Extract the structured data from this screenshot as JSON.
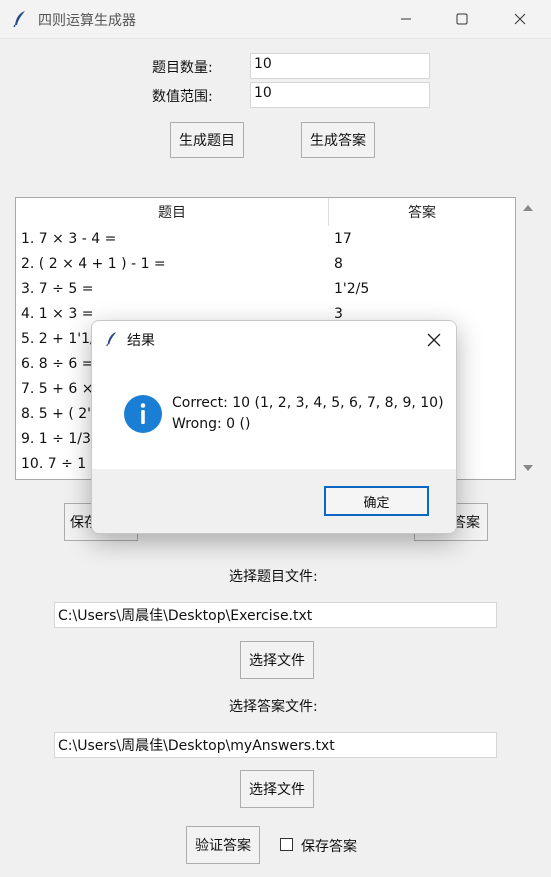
{
  "window": {
    "title": "四则运算生成器"
  },
  "form": {
    "count_label": "题目数量:",
    "count_value": "10",
    "range_label": "数值范围:",
    "range_value": "10",
    "generate_questions_label": "生成题目",
    "generate_answers_label": "生成答案"
  },
  "table": {
    "columns": [
      "题目",
      "答案"
    ],
    "rows": [
      {
        "q": "1. 7 × 3 - 4 =",
        "a": "17"
      },
      {
        "q": "2. ( 2 × 4 + 1 ) - 1 =",
        "a": "8"
      },
      {
        "q": "3. 7 ÷ 5 =",
        "a": "1'2/5"
      },
      {
        "q": "4. 1 × 3 =",
        "a": "3"
      },
      {
        "q": "5. 2 + 1'1/",
        "a": ""
      },
      {
        "q": "6. 8 ÷ 6 =",
        "a": ""
      },
      {
        "q": "7. 5 + 6 ×",
        "a": ""
      },
      {
        "q": "8. 5 + ( 2'",
        "a": ""
      },
      {
        "q": "9. 1 ÷ 1/3",
        "a": ""
      },
      {
        "q": "10. 7 ÷ 1",
        "a": ""
      }
    ]
  },
  "bottom": {
    "save_questions_label": "保存",
    "save_answers_label": "答案",
    "exercise_file_label": "选择题目文件:",
    "exercise_file_path": "C:\\Users\\周晨佳\\Desktop\\Exercise.txt",
    "choose_file_label": "选择文件",
    "answer_file_label": "选择答案文件:",
    "answer_file_path": "C:\\Users\\周晨佳\\Desktop\\myAnswers.txt",
    "choose_file_label_2": "选择文件",
    "verify_label": "验证答案",
    "save_answers_check_label": "保存答案",
    "save_answers_checked": false
  },
  "dialog": {
    "title": "结果",
    "correct_line": "Correct: 10 (1, 2, 3, 4, 5, 6, 7, 8, 9, 10)",
    "wrong_line": "Wrong: 0 ()",
    "ok_label": "确定",
    "icon": "info-icon",
    "accent_color": "#1a7fd4"
  }
}
